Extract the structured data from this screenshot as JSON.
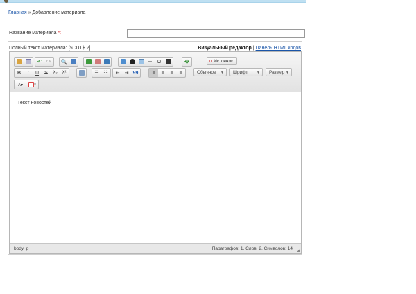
{
  "breadcrumb": {
    "home": "Главная",
    "separator": "»",
    "current": "Добавление материала"
  },
  "form": {
    "title_label": "Название материала",
    "required_mark": "*:",
    "title_value": "",
    "fulltext_label": "Полный текст материала: [$CUT$ ?]"
  },
  "editor_modes": {
    "visual": "Визуальный редактор",
    "sep": "|",
    "html": "Панель HTML кодов"
  },
  "toolbar": {
    "source_label": "Источник",
    "format_combo": "Обычное",
    "font_combo": "Шрифт",
    "size_combo": "Размер",
    "bold": "B",
    "italic": "I",
    "underline": "U",
    "strike": "S",
    "subscript": "X₂",
    "superscript": "X²",
    "blockquote": "99"
  },
  "content": {
    "text": "Текст новостей"
  },
  "statusbar": {
    "path_body": "body",
    "path_p": "p",
    "stats": "Параграфов: 1, Слов: 2, Символов: 14"
  },
  "colors": {
    "link": "#1a55a8",
    "required": "#dd3333",
    "toolbar_bg": "#e6e6e6"
  },
  "icons": [
    "paste-icon",
    "paste-text-icon",
    "undo-icon",
    "redo-icon",
    "find-icon",
    "replace-icon",
    "spellcheck-icon",
    "image-icon",
    "flash-icon",
    "table-icon",
    "hr-icon",
    "smiley-icon",
    "special-char-icon",
    "youtube-icon",
    "maximize-icon",
    "text-color-icon",
    "bg-color-icon"
  ]
}
